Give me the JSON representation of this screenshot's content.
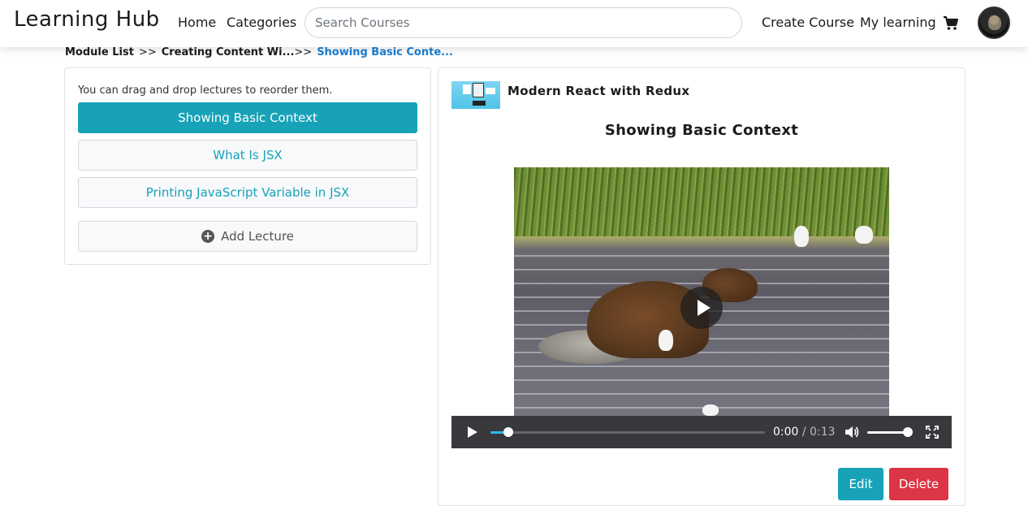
{
  "navbar": {
    "brand": "Learning Hub",
    "home": "Home",
    "categories": "Categories",
    "search_placeholder": "Search Courses",
    "create_course": "Create Course",
    "my_learning": "My learning"
  },
  "breadcrumb": {
    "items": [
      "Module List",
      "Creating Content Wi...",
      "Showing Basic Conte..."
    ],
    "separator": ">>"
  },
  "lecture_panel": {
    "hint": "You can drag and drop lectures to reorder them.",
    "lectures": [
      "Showing Basic Context",
      "What Is JSX",
      "Printing JavaScript Variable in JSX"
    ],
    "active_index": 0,
    "add_label": "Add Lecture"
  },
  "viewer": {
    "course_title": "Modern React with Redux",
    "lecture_title": "Showing Basic Context",
    "video": {
      "current_time": "0:00",
      "time_separator": "/",
      "duration": "0:13",
      "progress_fraction": 0.03,
      "volume_fraction": 1.0
    },
    "edit_label": "Edit",
    "delete_label": "Delete"
  },
  "colors": {
    "primary_teal": "#17a2b8",
    "danger_red": "#dc3545",
    "breadcrumb_active": "#1a7fd4"
  },
  "icons": [
    "cart-icon",
    "plus-circle-icon",
    "play-icon",
    "volume-icon",
    "fullscreen-icon"
  ]
}
